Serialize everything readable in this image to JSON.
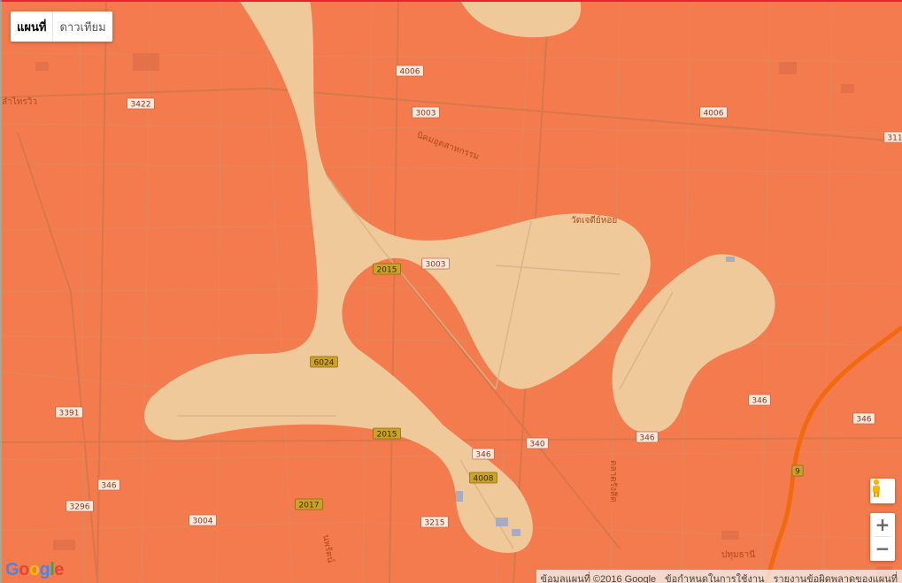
{
  "map_type_control": {
    "map_label": "แผนที่",
    "satellite_label": "ดาวเทียม",
    "selected": "map"
  },
  "colors": {
    "flood_zone": "#f47b4d",
    "safe_zone": "#f0c99a",
    "road_minor": "#d98a66",
    "highway": "#f26a10",
    "label_text": "#b0491f"
  },
  "road_shields": [
    "4006",
    "3003",
    "3422",
    "4006",
    "311",
    "3003",
    "2015",
    "6024",
    "3391",
    "2015",
    "346",
    "4008",
    "340",
    "346",
    "346",
    "346",
    "346",
    "3296",
    "3004",
    "2017",
    "3215",
    "9"
  ],
  "place_labels": [
    "วัดเจดีย์หอย",
    "นิคมอุตสาหกรรม",
    "ลำไทรวิว",
    "ตลาดรังสิต",
    "นพรัตน์",
    "ปทุมธานี"
  ],
  "zoom": {
    "in_label": "+",
    "out_label": "−"
  },
  "logo_text": "Google",
  "footer": {
    "map_data": "ข้อมูลแผนที่ ©2016 Google",
    "terms": "ข้อกำหนดในการใช้งาน",
    "report": "รายงานข้อผิดพลาดของแผนที่"
  }
}
